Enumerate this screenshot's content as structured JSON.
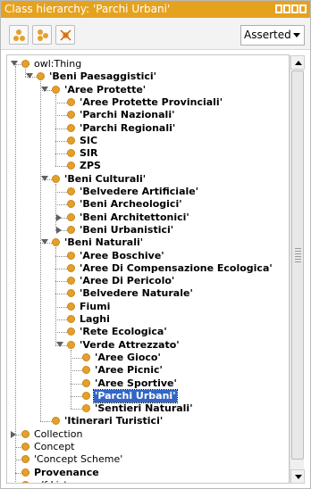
{
  "panel": {
    "title": "Class hierarchy: 'Parchi Urbani'",
    "mode_select": {
      "value": "Asserted"
    }
  },
  "toolbar": {
    "buttons": [
      {
        "name": "add-subclass-button",
        "icon": "add-subclass-icon"
      },
      {
        "name": "add-sibling-button",
        "icon": "add-sibling-icon"
      },
      {
        "name": "delete-class-button",
        "icon": "delete-class-icon"
      }
    ]
  },
  "tree": {
    "selected": "'Parchi Urbani'",
    "nodes": [
      {
        "label": "owl:Thing",
        "bold": false,
        "state": "open"
      },
      {
        "label": "'Beni Paesaggistici'",
        "bold": true,
        "state": "open"
      },
      {
        "label": "'Aree Protette'",
        "bold": true,
        "state": "open"
      },
      {
        "label": "'Aree Protette Provinciali'",
        "bold": true,
        "state": "leaf"
      },
      {
        "label": "'Parchi Nazionali'",
        "bold": true,
        "state": "leaf"
      },
      {
        "label": "'Parchi Regionali'",
        "bold": true,
        "state": "leaf"
      },
      {
        "label": "SIC",
        "bold": true,
        "state": "leaf"
      },
      {
        "label": "SIR",
        "bold": true,
        "state": "leaf"
      },
      {
        "label": "ZPS",
        "bold": true,
        "state": "leaf"
      },
      {
        "label": "'Beni Culturali'",
        "bold": true,
        "state": "open"
      },
      {
        "label": "'Belvedere Artificiale'",
        "bold": true,
        "state": "leaf"
      },
      {
        "label": "'Beni Archeologici'",
        "bold": true,
        "state": "leaf"
      },
      {
        "label": "'Beni Architettonici'",
        "bold": true,
        "state": "closed"
      },
      {
        "label": "'Beni Urbanistici'",
        "bold": true,
        "state": "closed"
      },
      {
        "label": "'Beni Naturali'",
        "bold": true,
        "state": "open"
      },
      {
        "label": "'Aree Boschive'",
        "bold": true,
        "state": "leaf"
      },
      {
        "label": "'Aree Di Compensazione Ecologica'",
        "bold": true,
        "state": "leaf"
      },
      {
        "label": "'Aree Di Pericolo'",
        "bold": true,
        "state": "leaf"
      },
      {
        "label": "'Belvedere Naturale'",
        "bold": true,
        "state": "leaf"
      },
      {
        "label": "Fiumi",
        "bold": true,
        "state": "leaf"
      },
      {
        "label": "Laghi",
        "bold": true,
        "state": "leaf"
      },
      {
        "label": "'Rete Ecologica'",
        "bold": true,
        "state": "leaf"
      },
      {
        "label": "'Verde Attrezzato'",
        "bold": true,
        "state": "open"
      },
      {
        "label": "'Aree Gioco'",
        "bold": true,
        "state": "leaf"
      },
      {
        "label": "'Aree Picnic'",
        "bold": true,
        "state": "leaf"
      },
      {
        "label": "'Aree Sportive'",
        "bold": true,
        "state": "leaf"
      },
      {
        "label": "'Parchi Urbani'",
        "bold": true,
        "state": "leaf"
      },
      {
        "label": "'Sentieri Naturali'",
        "bold": true,
        "state": "leaf"
      },
      {
        "label": "'Itinerari Turistici'",
        "bold": true,
        "state": "leaf"
      },
      {
        "label": "Collection",
        "bold": false,
        "state": "closed"
      },
      {
        "label": "Concept",
        "bold": false,
        "state": "leaf"
      },
      {
        "label": "'Concept Scheme'",
        "bold": false,
        "state": "leaf"
      },
      {
        "label": "Provenance",
        "bold": true,
        "state": "leaf"
      },
      {
        "label": "rdf:List",
        "bold": false,
        "state": "leaf"
      }
    ]
  },
  "colors": {
    "title_bar": "#e5a21f",
    "class_dot": "#e4a02c",
    "selection": "#3166c6"
  }
}
